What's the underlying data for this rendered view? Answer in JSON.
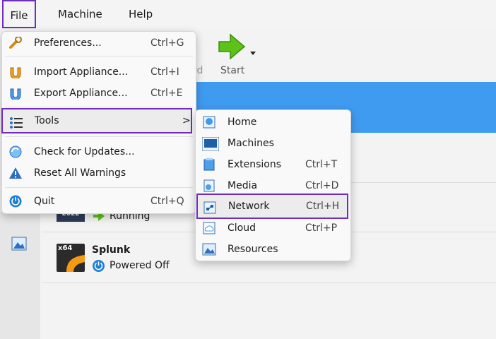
{
  "menubar": {
    "file": "File",
    "machine": "Machine",
    "help": "Help"
  },
  "toolbar": {
    "wizard_partial": "rd",
    "start": "Start"
  },
  "file_menu": {
    "items": [
      {
        "label": "Preferences...",
        "shortcut": "Ctrl+G",
        "icon": "wrench-icon"
      },
      {
        "label": "Import Appliance...",
        "shortcut": "Ctrl+I",
        "icon": "import-icon"
      },
      {
        "label": "Export Appliance...",
        "shortcut": "Ctrl+E",
        "icon": "export-icon"
      },
      {
        "label": "Tools",
        "shortcut": ">",
        "icon": "tools-list-icon"
      },
      {
        "label": "Check for Updates...",
        "shortcut": "",
        "icon": "refresh-icon"
      },
      {
        "label": "Reset All Warnings",
        "shortcut": "",
        "icon": "warning-icon"
      },
      {
        "label": "Quit",
        "shortcut": "Ctrl+Q",
        "icon": "power-icon"
      }
    ]
  },
  "tools_menu": {
    "items": [
      {
        "label": "Home",
        "shortcut": "",
        "icon": "home-icon"
      },
      {
        "label": "Machines",
        "shortcut": "",
        "icon": "machines-icon"
      },
      {
        "label": "Extensions",
        "shortcut": "Ctrl+T",
        "icon": "extensions-icon"
      },
      {
        "label": "Media",
        "shortcut": "Ctrl+D",
        "icon": "media-icon"
      },
      {
        "label": "Network",
        "shortcut": "Ctrl+H",
        "icon": "network-icon"
      },
      {
        "label": "Cloud",
        "shortcut": "Ctrl+P",
        "icon": "cloud-icon"
      },
      {
        "label": "Resources",
        "shortcut": "",
        "icon": "resources-icon"
      }
    ]
  },
  "vms": [
    {
      "os_badge": "2022",
      "state": "Running"
    },
    {
      "os_badge": "x64",
      "name": "Splunk",
      "state": "Powered Off"
    }
  ],
  "colors": {
    "highlight_border": "#6f2dbd",
    "accent_blue": "#3f9bf0",
    "start_green": "#5cc21a"
  }
}
